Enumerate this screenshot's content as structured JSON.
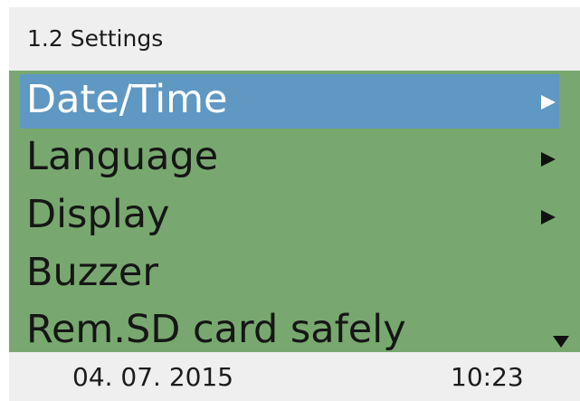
{
  "header": {
    "title": "1.2 Settings"
  },
  "menu": {
    "items": [
      {
        "label": "Date/Time",
        "selected": true,
        "submenu": true,
        "icon": "triangle-right-icon"
      },
      {
        "label": "Language",
        "selected": false,
        "submenu": true,
        "icon": "triangle-right-icon"
      },
      {
        "label": "Display",
        "selected": false,
        "submenu": true,
        "icon": "triangle-right-icon"
      },
      {
        "label": "Buzzer",
        "selected": false,
        "submenu": false
      },
      {
        "label": "Rem.SD card safely",
        "selected": false,
        "submenu": false
      }
    ],
    "scroll_indicator": "triangle-down-icon"
  },
  "footer": {
    "date": "04. 07. 2015",
    "time": "10:23"
  },
  "colors": {
    "header_bg": "#efefef",
    "menu_bg": "#78a86f",
    "selected_bg": "#5f98c2",
    "text": "#161616",
    "selected_text": "#ffffff"
  }
}
